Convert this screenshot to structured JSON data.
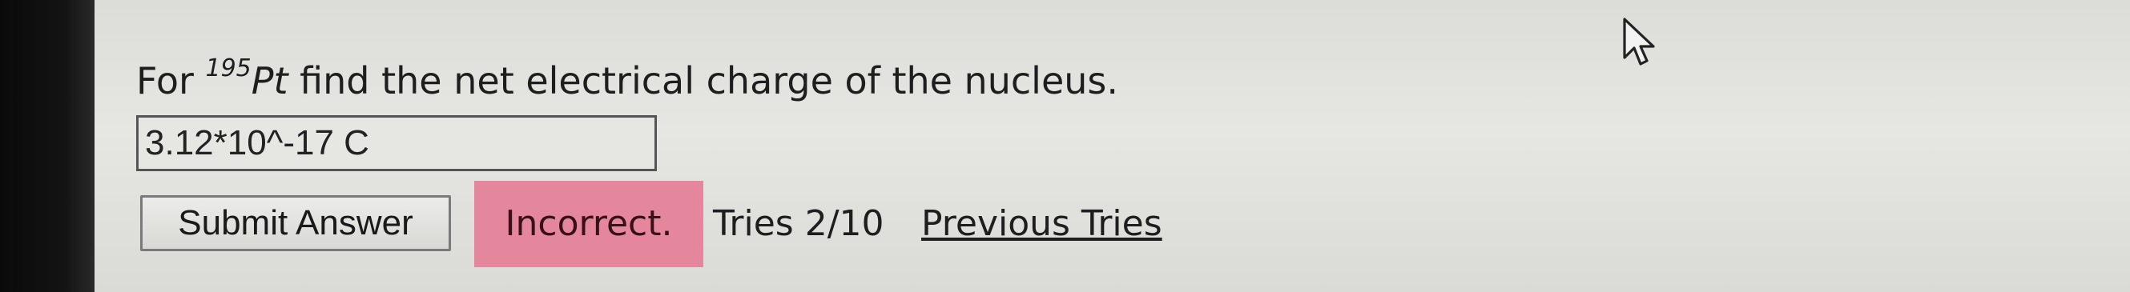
{
  "question": {
    "prefix": "For ",
    "mass_number": "195",
    "element": "Pt",
    "text": " find the net electrical charge of the nucleus."
  },
  "answer": {
    "value": "3.12*10^-17 C"
  },
  "submit": {
    "label": "Submit Answer"
  },
  "status": {
    "label": "Incorrect.",
    "color": "#e4879c"
  },
  "tries": {
    "text": "Tries 2/10"
  },
  "previous_tries": {
    "label": "Previous Tries"
  },
  "cursor": {
    "icon": "mouse-pointer-icon"
  }
}
